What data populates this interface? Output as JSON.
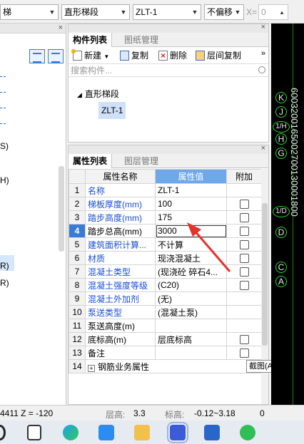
{
  "toolbar": {
    "combo1": "梯",
    "combo2": "直形梯段",
    "combo3": "ZLT-1",
    "combo4": "不偏移",
    "x_label": "X=",
    "x_value": "0"
  },
  "left_panel": {
    "labels": [
      "S)",
      "H)",
      "R)",
      "R)"
    ]
  },
  "component_panel": {
    "tabs": [
      "构件列表",
      "图纸管理"
    ],
    "buttons": {
      "new": "新建",
      "copy": "复制",
      "delete": "删除",
      "floor_copy": "层间复制"
    },
    "more": "»",
    "search_placeholder": "搜索构件...",
    "tree": {
      "root": "直形梯段",
      "children": [
        "ZLT-1"
      ]
    }
  },
  "property_panel": {
    "tabs": [
      "属性列表",
      "图层管理"
    ],
    "headers": {
      "name": "属性名称",
      "value": "属性值",
      "extra": "附加"
    },
    "rows": [
      {
        "num": "1",
        "name": "名称",
        "value": "ZLT-1",
        "blue": true,
        "checkbox": false
      },
      {
        "num": "2",
        "name": "梯板厚度(mm)",
        "value": "100",
        "blue": true,
        "checkbox": true
      },
      {
        "num": "3",
        "name": "踏步高度(mm)",
        "value": "175",
        "blue": true,
        "checkbox": true
      },
      {
        "num": "4",
        "name": "踏步总高(mm)",
        "value": "3000",
        "blue": false,
        "checkbox": true
      },
      {
        "num": "5",
        "name": "建筑面积计算...",
        "value": "不计算",
        "blue": true,
        "checkbox": true
      },
      {
        "num": "6",
        "name": "材质",
        "value": "现浇混凝土",
        "blue": true,
        "checkbox": true
      },
      {
        "num": "7",
        "name": "混凝土类型",
        "value": "(现浇砼 碎石4...",
        "blue": true,
        "checkbox": true
      },
      {
        "num": "8",
        "name": "混凝土强度等级",
        "value": "(C20)",
        "blue": true,
        "checkbox": true
      },
      {
        "num": "9",
        "name": "混凝土外加剂",
        "value": "(无)",
        "blue": true,
        "checkbox": false
      },
      {
        "num": "10",
        "name": "泵送类型",
        "value": "(混凝土泵)",
        "blue": true,
        "checkbox": false
      },
      {
        "num": "11",
        "name": "泵送高度(m)",
        "value": "",
        "blue": false,
        "checkbox": false
      },
      {
        "num": "12",
        "name": "底标高(m)",
        "value": "层底标高",
        "blue": false,
        "checkbox": true
      },
      {
        "num": "13",
        "name": "备注",
        "value": "",
        "blue": false,
        "checkbox": true
      },
      {
        "num": "14",
        "name": "钢筋业务属性",
        "value": "",
        "blue": false,
        "checkbox": false,
        "group": true
      }
    ]
  },
  "tooltip": "截图(Alt + A)",
  "canvas": {
    "axis_labels": [
      "K",
      "J",
      "1/H",
      "H",
      "G",
      "1/D",
      "D",
      "C",
      "A"
    ],
    "vertical_text": "6003200165002700130001800"
  },
  "status": {
    "coords": "4411 Z = -120",
    "floor_height_label": "层高:",
    "floor_height": "3.3",
    "elevation_label": "标高:",
    "elevation": "-0.12~3.18",
    "extra": "0"
  },
  "colors": {
    "accent": "#3a7bd5",
    "header_value": "#6fa8ea",
    "link_blue": "#1b4fd1",
    "arrow_red": "#e5312b",
    "canvas_bg": "#000000",
    "axis_green": "#2bd92b"
  }
}
